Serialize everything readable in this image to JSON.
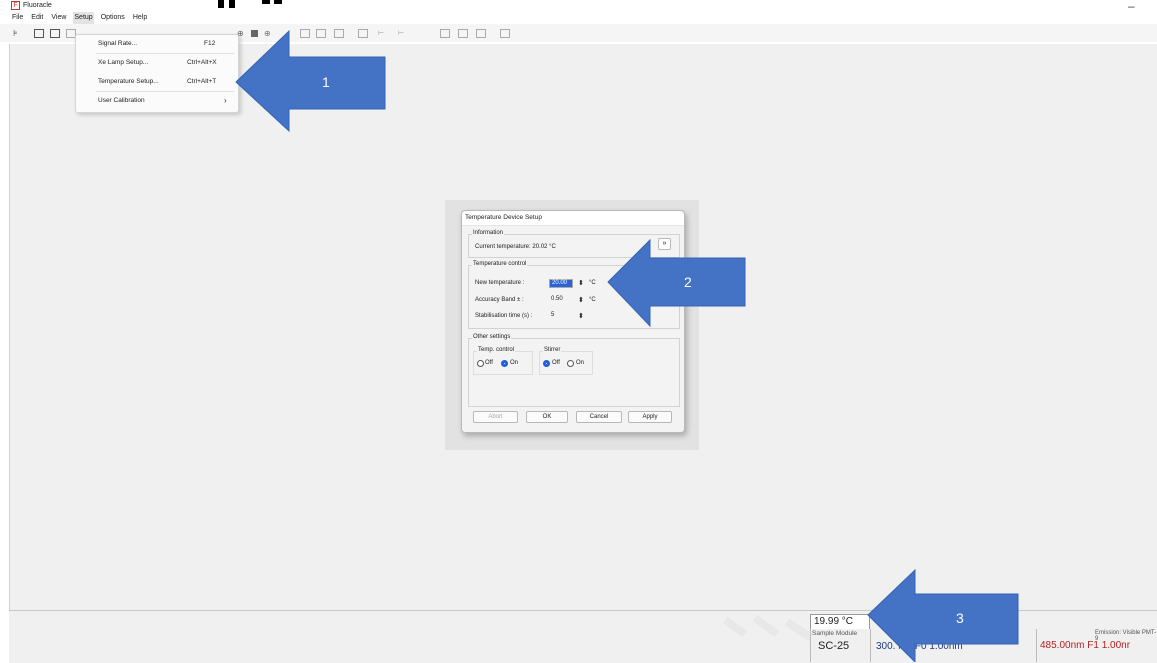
{
  "app": {
    "title": "Fluoracle",
    "minimize": "–"
  },
  "menu": [
    "File",
    "Edit",
    "View",
    "Setup",
    "Options",
    "Help"
  ],
  "setup_menu": [
    {
      "label": "Signal Rate...",
      "shortcut": "F12"
    },
    {
      "label": "Xe Lamp Setup...",
      "shortcut": "Ctrl+Alt+X"
    },
    {
      "label": "Temperature Setup...",
      "shortcut": "Ctrl+Alt+T"
    },
    {
      "label": "User Calibration",
      "submenu": "›"
    }
  ],
  "dialog": {
    "title": "Temperature Device Setup",
    "information": {
      "legend": "Information",
      "current_temperature": "Current temperature: 20.02 °C",
      "expand": "»"
    },
    "temperature_control": {
      "legend": "Temperature control",
      "new_temp_label": "New temperature :",
      "new_temp_value": "20.00",
      "accuracy_label": "Accuracy Band ± :",
      "accuracy_value": "0.50",
      "stab_label": "Stabilisation time (s) :",
      "stab_value": "5",
      "unit": "°C"
    },
    "other_settings": {
      "legend": "Other settings",
      "temp_control_label": "Temp. control",
      "stirrer_label": "Stirrer",
      "off": "Off",
      "on": "On",
      "temp_control_state": "On",
      "stirrer_state": "Off"
    },
    "buttons": {
      "abort": "Abort",
      "ok": "OK",
      "cancel": "Cancel",
      "apply": "Apply"
    }
  },
  "status": {
    "temperature": "19.99 °C",
    "module_label": "Sample Module",
    "module_value": "SC-25",
    "excitation": "300.   nm  F0  1.00nm",
    "emission_label": "Emission: Visible PMT-9",
    "emission_value": "485.00nm  F1  1.00nr"
  },
  "annotations": [
    "1",
    "2",
    "3"
  ],
  "colors": {
    "arrow": "#4472c4",
    "accent": "#1e5bd6",
    "emission": "#b22222"
  }
}
